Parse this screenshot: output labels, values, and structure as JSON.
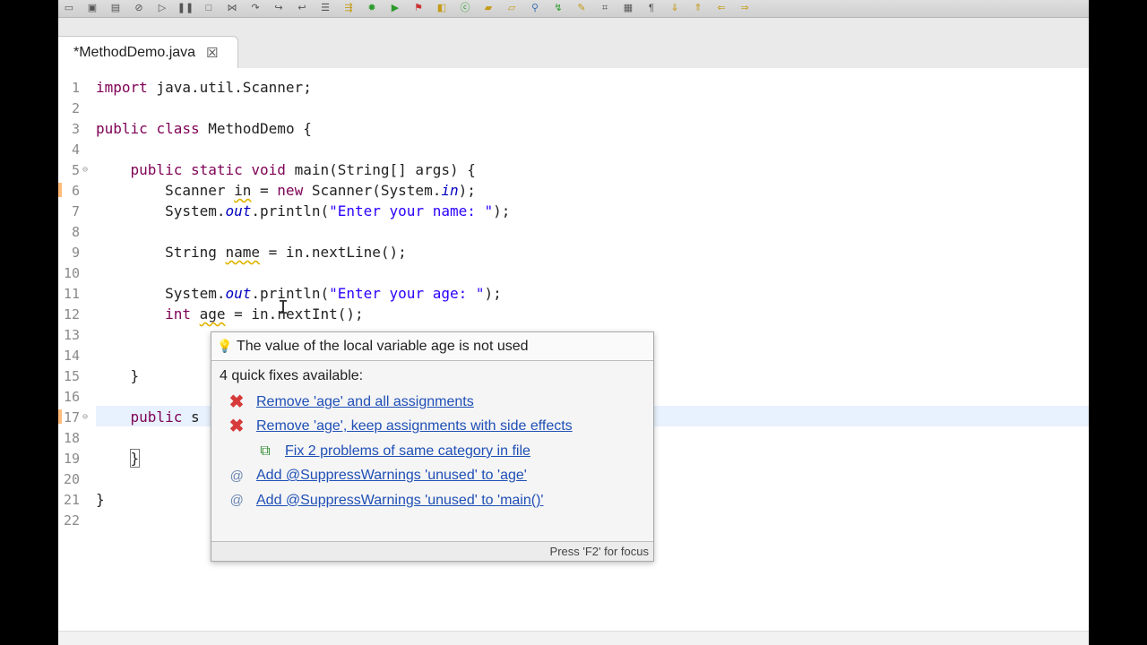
{
  "editor": {
    "tab_title": "*MethodDemo.java",
    "tab_close_icon": "close-x-icon"
  },
  "code": {
    "lines": [
      {
        "n": "1"
      },
      {
        "n": "2"
      },
      {
        "n": "3"
      },
      {
        "n": "4"
      },
      {
        "n": "5"
      },
      {
        "n": "6"
      },
      {
        "n": "7"
      },
      {
        "n": "8"
      },
      {
        "n": "9"
      },
      {
        "n": "10"
      },
      {
        "n": "11"
      },
      {
        "n": "12"
      },
      {
        "n": "13"
      },
      {
        "n": "14"
      },
      {
        "n": "15"
      },
      {
        "n": "16"
      },
      {
        "n": "17"
      },
      {
        "n": "18"
      },
      {
        "n": "19"
      },
      {
        "n": "20"
      },
      {
        "n": "21"
      },
      {
        "n": "22"
      }
    ],
    "t": {
      "import": "import",
      "java_util_scanner": " java.util.Scanner;",
      "public": "public",
      "class": "class",
      "class_decl_rest": " MethodDemo {",
      "static": "static",
      "void": "void",
      "main_sig": " main(String[] args) {",
      "scanner_type": "Scanner ",
      "var_in": "in",
      "eq": " = ",
      "new": "new",
      "scanner_ctor": " Scanner(System.",
      "field_in": "in",
      "close_paren_semi": ");",
      "system": "System.",
      "field_out": "out",
      "println_open": ".println(",
      "str_enter_name": "\"Enter your name: \"",
      "string_type": "String ",
      "var_name": "name",
      "next_line": " = in.nextLine();",
      "str_enter_age": "\"Enter your age: \"",
      "int": "int",
      "var_age": "age",
      "next_int": " = in.nextInt();",
      "close_brace": "}",
      "public_s": " s"
    }
  },
  "quickfix": {
    "title": "The value of the local variable age is not used",
    "subtitle": "4 quick fixes available:",
    "fixes": [
      {
        "label": "Remove 'age' and all assignments",
        "icon": "remove-x-icon"
      },
      {
        "label": "Remove 'age', keep assignments with side effects",
        "icon": "remove-x-icon"
      },
      {
        "label": "Fix 2 problems of same category in file",
        "icon": "multi-fix-icon"
      },
      {
        "label": "Add @SuppressWarnings 'unused' to 'age'",
        "icon": "annotation-at-icon"
      },
      {
        "label": "Add @SuppressWarnings 'unused' to 'main()'",
        "icon": "annotation-at-icon"
      }
    ],
    "footer": "Press 'F2' for focus"
  }
}
